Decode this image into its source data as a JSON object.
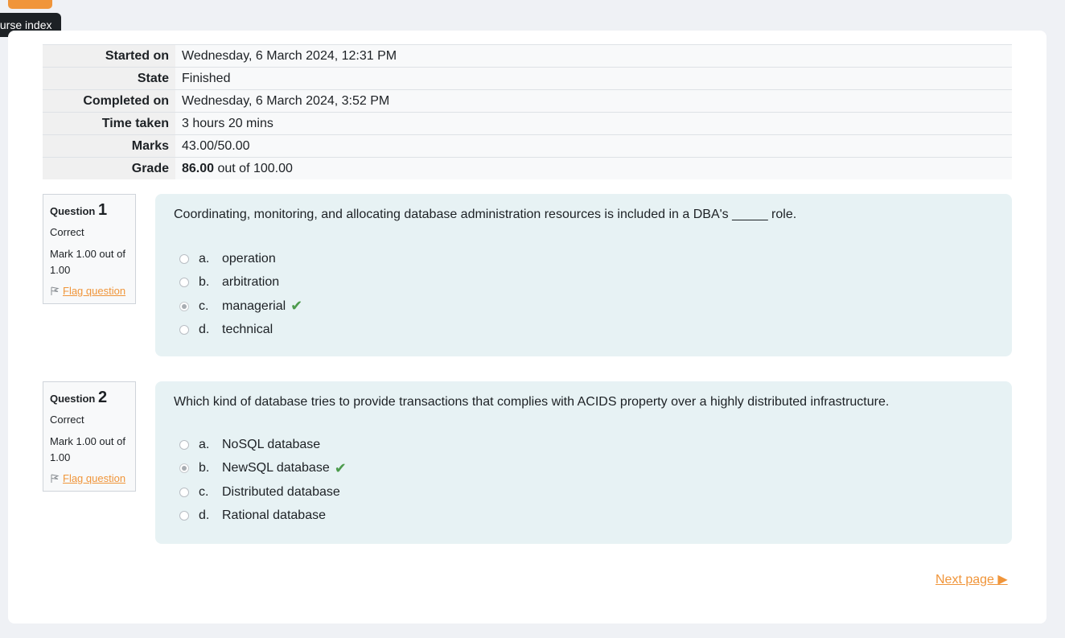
{
  "tooltip": "Course index",
  "summary": [
    {
      "label": "Started on",
      "value": "Wednesday, 6 March 2024, 12:31 PM"
    },
    {
      "label": "State",
      "value": "Finished"
    },
    {
      "label": "Completed on",
      "value": "Wednesday, 6 March 2024, 3:52 PM"
    },
    {
      "label": "Time taken",
      "value": "3 hours 20 mins"
    },
    {
      "label": "Marks",
      "value": "43.00/50.00"
    },
    {
      "label": "Grade",
      "value_bold": "86.00",
      "value_rest": " out of 100.00"
    }
  ],
  "questions": [
    {
      "prefix": "Question",
      "number": "1",
      "state": "Correct",
      "grade": "Mark 1.00 out of 1.00",
      "flag": "Flag question",
      "text": "Coordinating, monitoring, and allocating database administration resources is included in a DBA's _____ role.",
      "answers": [
        {
          "letter": "a.",
          "label": "operation"
        },
        {
          "letter": "b.",
          "label": "arbitration"
        },
        {
          "letter": "c.",
          "label": "managerial"
        },
        {
          "letter": "d.",
          "label": "technical"
        }
      ],
      "selected_index": 2
    },
    {
      "prefix": "Question",
      "number": "2",
      "state": "Correct",
      "grade": "Mark 1.00 out of 1.00",
      "flag": "Flag question",
      "text": "Which kind of database tries to provide transactions that complies with ACIDS property over a highly distributed infrastructure.",
      "answers": [
        {
          "letter": "a.",
          "label": "NoSQL database"
        },
        {
          "letter": "b.",
          "label": "NewSQL database"
        },
        {
          "letter": "c.",
          "label": "Distributed database"
        },
        {
          "letter": "d.",
          "label": "Rational database"
        }
      ],
      "selected_index": 1
    }
  ],
  "next_page": "Next page ▶"
}
